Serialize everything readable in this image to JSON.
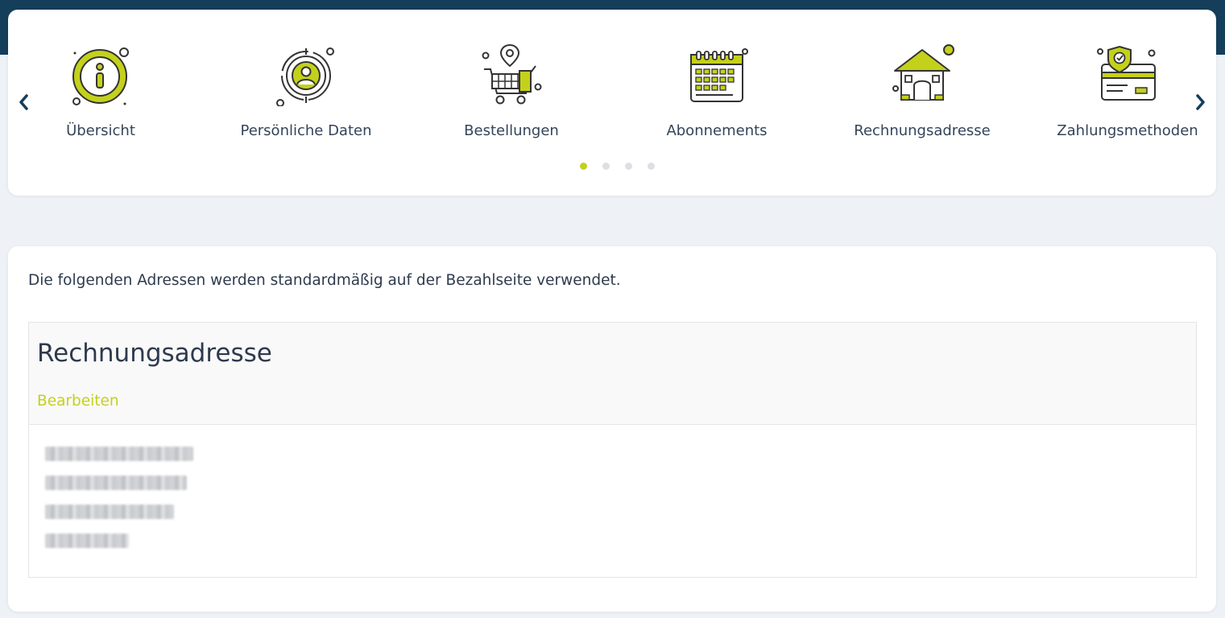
{
  "colors": {
    "accent": "#c4d11b",
    "topbar": "#153e5a",
    "text": "#2e3a4d"
  },
  "nav": {
    "prev_icon": "chevron-left-icon",
    "next_icon": "chevron-right-icon",
    "items": [
      {
        "label": "Übersicht",
        "icon": "info-icon"
      },
      {
        "label": "Persönliche Daten",
        "icon": "user-target-icon"
      },
      {
        "label": "Bestellungen",
        "icon": "cart-icon"
      },
      {
        "label": "Abonnements",
        "icon": "calendar-icon"
      },
      {
        "label": "Rechnungsadresse",
        "icon": "house-icon"
      },
      {
        "label": "Zahlungsmethoden",
        "icon": "card-shield-icon"
      }
    ],
    "pagination": {
      "pages": 4,
      "active": 1
    }
  },
  "main": {
    "intro": "Die folgenden Adressen werden standardmäßig auf der Bezahlseite verwendet.",
    "billing": {
      "title": "Rechnungsadresse",
      "edit_label": "Bearbeiten"
    }
  }
}
